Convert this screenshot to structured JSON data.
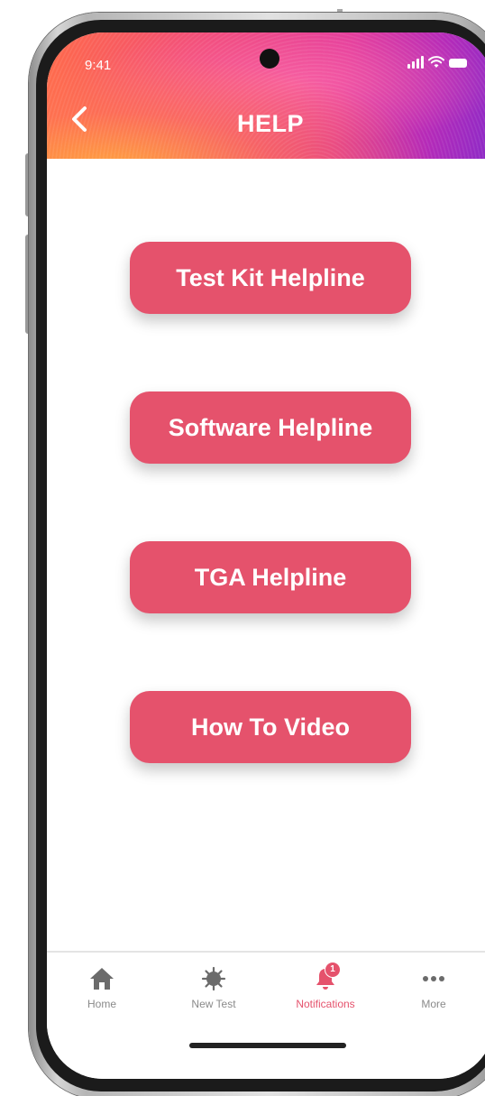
{
  "status_bar": {
    "time": "9:41"
  },
  "header": {
    "title": "HELP",
    "back_icon": "chevron-left-icon"
  },
  "buttons": [
    {
      "label": "Test Kit Helpline"
    },
    {
      "label": "Software Helpline"
    },
    {
      "label": "TGA Helpline"
    },
    {
      "label": "How To Video"
    }
  ],
  "tabbar": {
    "items": [
      {
        "label": "Home",
        "icon": "home-icon",
        "active": false
      },
      {
        "label": "New Test",
        "icon": "virus-icon",
        "active": false
      },
      {
        "label": "Notifications",
        "icon": "bell-icon",
        "active": true,
        "badge": "1"
      },
      {
        "label": "More",
        "icon": "more-dots-icon",
        "active": false
      }
    ]
  },
  "colors": {
    "accent": "#e5526c",
    "tab_inactive": "#8a8a8a",
    "header_gradient": [
      "#ff6a4a",
      "#f04a78",
      "#e0379a",
      "#b52ab8",
      "#8a2ac8"
    ]
  }
}
